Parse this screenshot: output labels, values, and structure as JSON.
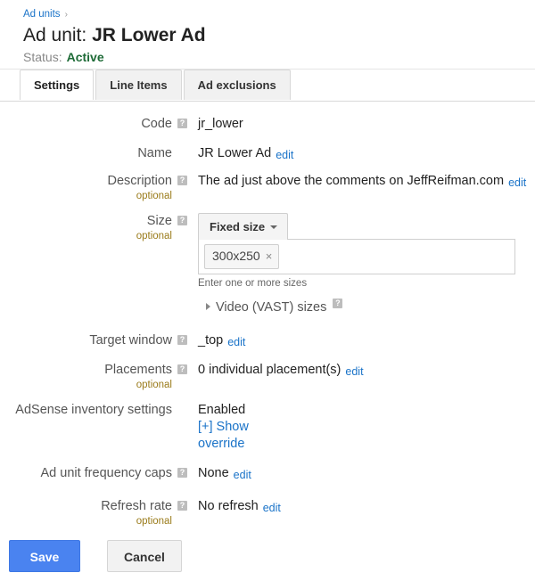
{
  "header": {
    "breadcrumb_label": "Ad units",
    "breadcrumb_separator": "›",
    "title_prefix": "Ad unit:",
    "title_name": "JR Lower Ad",
    "status_label": "Status:",
    "status_value": "Active",
    "status_color": "#1e6b37"
  },
  "tabs": [
    {
      "label": "Settings",
      "active": true
    },
    {
      "label": "Line Items",
      "active": false
    },
    {
      "label": "Ad exclusions",
      "active": false
    }
  ],
  "help_glyph": "?",
  "form": {
    "code": {
      "label": "Code",
      "value": "jr_lower"
    },
    "name": {
      "label": "Name",
      "value": "JR Lower Ad",
      "edit_label": "edit"
    },
    "description": {
      "label": "Description",
      "optional_label": "optional",
      "value": "The ad just above the comments on JeffReifman.com",
      "edit_label": "edit"
    },
    "size": {
      "label": "Size",
      "optional_label": "optional",
      "select_value": "Fixed size",
      "chips": [
        "300x250"
      ],
      "chip_remove_glyph": "×",
      "helper_text": "Enter one or more sizes",
      "vast_label": "Video (VAST) sizes"
    },
    "target_window": {
      "label": "Target window",
      "value": "_top",
      "edit_label": "edit"
    },
    "placements": {
      "label": "Placements",
      "optional_label": "optional",
      "value": "0 individual placement(s)",
      "edit_label": "edit"
    },
    "adsense": {
      "label": "AdSense inventory settings",
      "value": "Enabled",
      "link_label": "[+] Show override"
    },
    "frequency_caps": {
      "label": "Ad unit frequency caps",
      "value": "None",
      "edit_label": "edit"
    },
    "refresh_rate": {
      "label": "Refresh rate",
      "optional_label": "optional",
      "value": "No refresh",
      "edit_label": "edit"
    }
  },
  "buttons": {
    "save_label": "Save",
    "cancel_label": "Cancel",
    "save_color": "#4a83f0"
  }
}
